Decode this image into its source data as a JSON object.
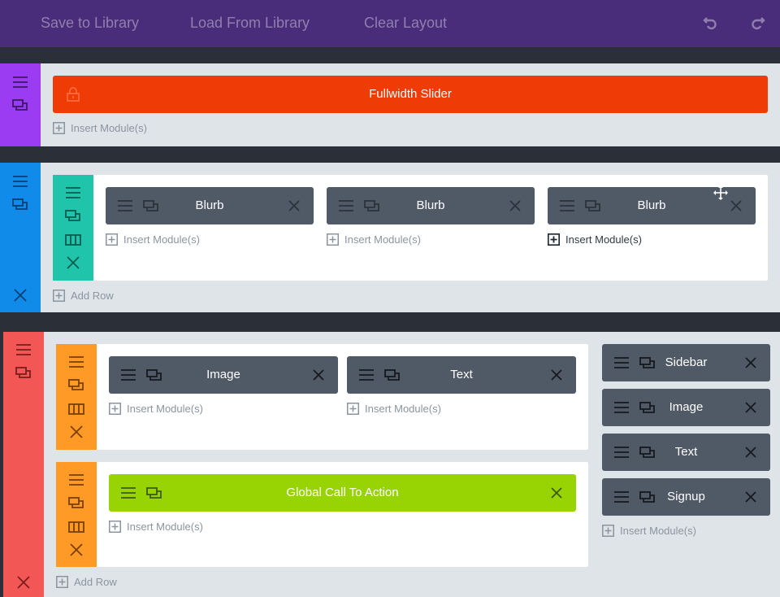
{
  "toolbar": {
    "save_label": "Save to Library",
    "load_label": "Load From Library",
    "clear_label": "Clear Layout",
    "undo_icon": "undo-icon",
    "redo_icon": "redo-icon"
  },
  "colors": {
    "toolbar_bg": "#4a2d7a",
    "section1_handle": "#9b3cf2",
    "section2_handle": "#108bea",
    "section3_handle": "#f25755",
    "row_teal": "#1fc4aa",
    "row_orange": "#ff9a27",
    "slider": "#ef3b06",
    "cta": "#98d303",
    "module": "#505a66"
  },
  "section1": {
    "slider_label": "Fullwidth Slider",
    "insert_label": "Insert Module(s)"
  },
  "section2": {
    "modules": [
      {
        "label": "Blurb"
      },
      {
        "label": "Blurb"
      },
      {
        "label": "Blurb"
      }
    ],
    "insert_label": "Insert Module(s)",
    "add_row_label": "Add Row"
  },
  "section3": {
    "row1": {
      "modules": [
        {
          "label": "Image"
        },
        {
          "label": "Text"
        }
      ],
      "insert_label": "Insert Module(s)"
    },
    "row2": {
      "cta_label": "Global Call To Action",
      "insert_label": "Insert Module(s)"
    },
    "sidebar": {
      "modules": [
        {
          "label": "Sidebar"
        },
        {
          "label": "Image"
        },
        {
          "label": "Text"
        },
        {
          "label": "Signup"
        }
      ],
      "insert_label": "Insert Module(s)"
    },
    "add_row_label": "Add Row"
  }
}
